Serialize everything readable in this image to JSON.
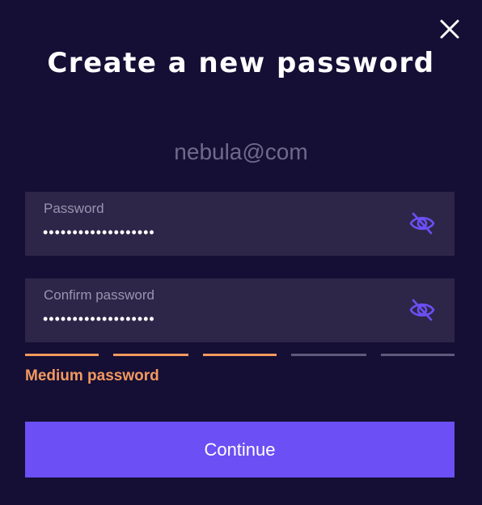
{
  "dialog": {
    "title": "Create a new password",
    "close_icon": "close-icon",
    "email": "nebula@com"
  },
  "password_field": {
    "label": "Password",
    "value": "•••••••••••••••••••",
    "toggle_icon": "eye-off-icon"
  },
  "confirm_field": {
    "label": "Confirm password",
    "value": "•••••••••••••••••••",
    "toggle_icon": "eye-off-icon"
  },
  "strength": {
    "label": "Medium password",
    "filled_segments": 3,
    "total_segments": 5
  },
  "continue_button": {
    "label": "Continue"
  },
  "colors": {
    "background": "#150f35",
    "field_background": "#2e2648",
    "accent": "#6c4ff5",
    "strength_medium": "#f2995f",
    "strength_empty": "#5f5a7b"
  }
}
